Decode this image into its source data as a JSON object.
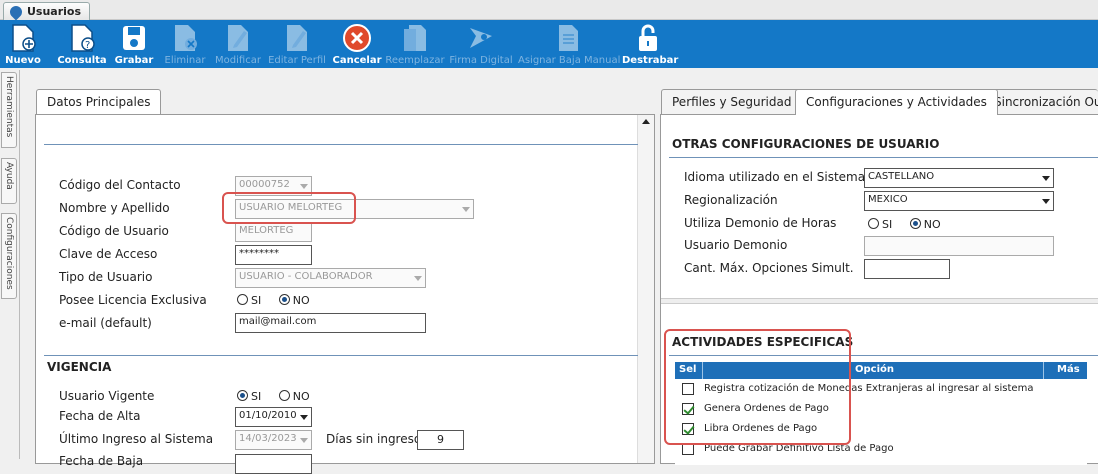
{
  "window": {
    "tab_title": "Usuarios"
  },
  "toolbar": {
    "buttons": [
      {
        "label": "Nuevo",
        "icon": "new-doc-icon",
        "enabled": true
      },
      {
        "label": "Consulta",
        "icon": "query-doc-icon",
        "enabled": true
      },
      {
        "label": "Grabar",
        "icon": "save-icon",
        "enabled": true
      },
      {
        "label": "Eliminar",
        "icon": "delete-doc-icon",
        "enabled": false
      },
      {
        "label": "Modificar",
        "icon": "edit-icon",
        "enabled": false
      },
      {
        "label": "Editar Perfil",
        "icon": "edit-profile-icon",
        "enabled": false
      },
      {
        "label": "Cancelar",
        "icon": "cancel-icon",
        "enabled": true
      },
      {
        "label": "Reemplazar",
        "icon": "replace-icon",
        "enabled": false
      },
      {
        "label": "Firma Digital",
        "icon": "signature-icon",
        "enabled": false
      },
      {
        "label": "Asignar Baja Manual",
        "icon": "assign-icon",
        "enabled": false
      },
      {
        "label": "Destrabar",
        "icon": "unlock-icon",
        "enabled": true
      }
    ],
    "accent": "#1478c7"
  },
  "sidetabs": [
    "Herramientas",
    "Ayuda",
    "Configuraciones"
  ],
  "left": {
    "tab": "Datos Principales",
    "fields": {
      "codigo_contacto": {
        "label": "Código del Contacto",
        "value": "00000752"
      },
      "nombre": {
        "label": "Nombre y Apellido",
        "value": "USUARIO MELORTEG"
      },
      "codigo_usuario": {
        "label": "Código de Usuario",
        "value": "MELORTEG"
      },
      "clave": {
        "label": "Clave de Acceso",
        "value": "********"
      },
      "tipo": {
        "label": "Tipo de Usuario",
        "value": "USUARIO - COLABORADOR"
      },
      "licencia": {
        "label": "Posee Licencia Exclusiva",
        "opt_si": "SI",
        "opt_no": "NO",
        "selected": "NO"
      },
      "email": {
        "label": "e-mail (default)",
        "value": "mail@mail.com"
      }
    },
    "vigencia": {
      "header": "VIGENCIA",
      "vigente": {
        "label": "Usuario Vigente",
        "opt_si": "SI",
        "opt_no": "NO",
        "selected": "SI"
      },
      "fecha_alta": {
        "label": "Fecha de Alta",
        "value": "01/10/2010"
      },
      "ultimo_ingreso": {
        "label": "Último Ingreso al Sistema",
        "value": "14/03/2023"
      },
      "dias_label": "Días sin ingreso",
      "dias_value": "9",
      "fecha_baja_label": "Fecha de Baja"
    }
  },
  "right": {
    "tabs": [
      "Perfiles y Seguridad",
      "Configuraciones y Actividades",
      "Sincronización Out"
    ],
    "active_tab": 1,
    "otras": {
      "header": "OTRAS CONFIGURACIONES DE USUARIO",
      "idioma": {
        "label": "Idioma utilizado en el Sistema",
        "value": "CASTELLANO"
      },
      "region": {
        "label": "Regionalización",
        "value": "MEXICO"
      },
      "demonio": {
        "label": "Utiliza Demonio de Horas",
        "opt_si": "SI",
        "opt_no": "NO",
        "selected": "NO"
      },
      "usuario_demonio": {
        "label": "Usuario Demonio",
        "value": ""
      },
      "cant_max": {
        "label": "Cant. Máx. Opciones Simult.",
        "value": ""
      }
    },
    "actividades": {
      "header": "ACTIVIDADES ESPECIFICAS",
      "columns": [
        "Sel",
        "Opción",
        "Más"
      ],
      "rows": [
        {
          "checked": false,
          "text": "Registra cotización de Monedas Extranjeras al ingresar al sistema"
        },
        {
          "checked": true,
          "text": "Genera Ordenes de Pago"
        },
        {
          "checked": true,
          "text": "Libra Ordenes de Pago"
        },
        {
          "checked": false,
          "text": "Puede Grabar Definitivo Lista de Pago"
        }
      ]
    }
  },
  "colors": {
    "highlight": "#d9534f",
    "grid_header": "#1e6fb8"
  }
}
